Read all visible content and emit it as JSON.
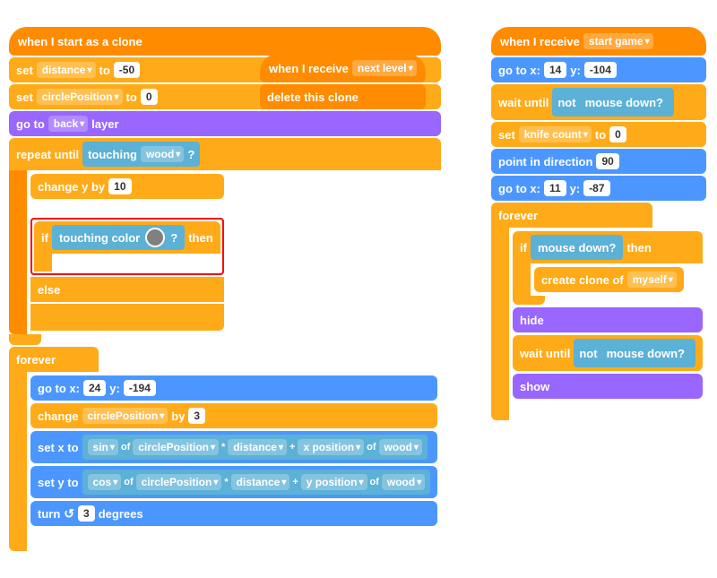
{
  "left_panel": {
    "hat_block": {
      "label": "when I start as a clone",
      "color": "#FF8C00"
    },
    "blocks": [
      {
        "type": "set",
        "var": "distance",
        "to": "-50"
      },
      {
        "type": "set",
        "var": "circlePosition",
        "to": "0"
      },
      {
        "type": "goto_layer",
        "layer": "back"
      },
      {
        "type": "repeat_until",
        "condition": "touching",
        "val": "wood"
      },
      {
        "type": "change_y",
        "val": "10"
      },
      {
        "type": "if_touching_color"
      },
      {
        "type": "else"
      },
      {
        "type": "forever"
      },
      {
        "type": "goto_xy",
        "x": "24",
        "y": "-194"
      },
      {
        "type": "change_circle",
        "by": "3"
      },
      {
        "type": "set_x_sin"
      },
      {
        "type": "set_y_cos"
      },
      {
        "type": "turn_3_degrees"
      }
    ]
  },
  "middle_panel": {
    "hat_label": "when I receive",
    "event": "next level",
    "delete_label": "delete this clone"
  },
  "right_panel": {
    "hat_label": "when I receive",
    "event": "start game",
    "goto_x": "14",
    "goto_y": "-104",
    "wait_label": "wait until",
    "not_label": "not",
    "mouse_down1": "mouse down?",
    "set_label": "set",
    "knife_count": "knife count",
    "to_label": "to",
    "knife_val": "0",
    "point_label": "point in direction",
    "direction": "90",
    "goto2_x": "11",
    "goto2_y": "-87",
    "forever_label": "forever",
    "if_label": "if",
    "mouse_down2": "mouse down?",
    "then_label": "then",
    "create_label": "create clone of",
    "myself": "myself",
    "hide_label": "hide",
    "wait2_label": "wait until",
    "not2_label": "not",
    "mouse_down3": "mouse down?",
    "show_label": "show"
  },
  "labels": {
    "set": "set",
    "to": "to",
    "go_to": "go to",
    "layer": "layer",
    "repeat_until": "repeat until",
    "touching": "touching",
    "change_y": "change y by",
    "if": "if",
    "touching_color": "touching color",
    "then": "then",
    "else": "else",
    "forever": "forever",
    "go_to_x": "go to x:",
    "y_label": "y:",
    "change": "change",
    "by": "by",
    "set_x": "set x to",
    "sin": "sin",
    "of": "of",
    "circlePosition": "circlePosition",
    "multiply": "*",
    "distance": "distance",
    "plus": "+",
    "x_position": "x position",
    "wood": "wood",
    "set_y": "set y to",
    "cos": "cos",
    "y_position": "y position",
    "turn": "turn",
    "degrees": "degrees",
    "back": "back"
  }
}
